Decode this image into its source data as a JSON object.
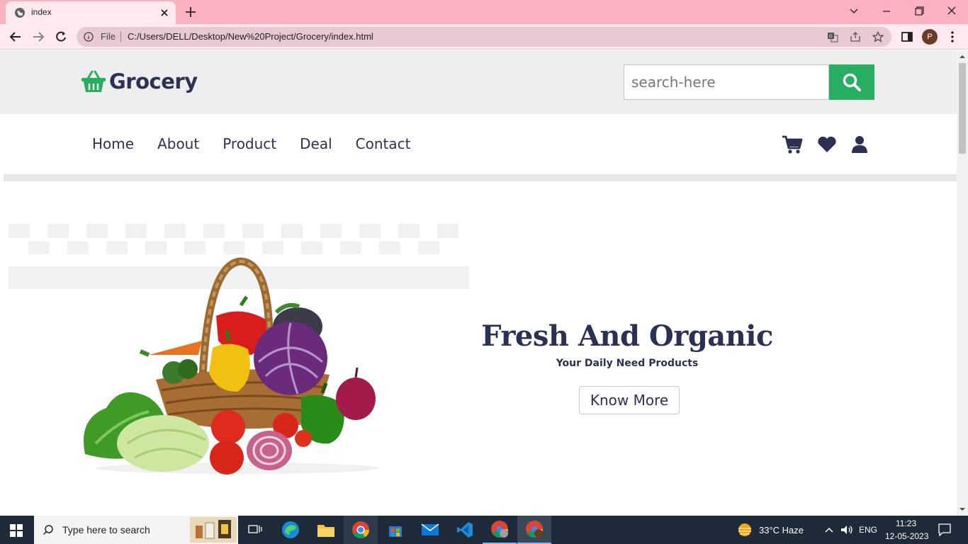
{
  "browser": {
    "tab_title": "index",
    "address": {
      "scheme_label": "File",
      "url": "C:/Users/DELL/Desktop/New%20Project/Grocery/index.html"
    },
    "profile_initial": "P"
  },
  "site": {
    "logo_text": "Grocery",
    "search": {
      "placeholder": "search-here"
    },
    "nav": [
      "Home",
      "About",
      "Product",
      "Deal",
      "Contact"
    ],
    "hero": {
      "title": "Fresh And Organic",
      "subtitle": "Your Daily Need Products",
      "button": "Know More"
    }
  },
  "taskbar": {
    "search_placeholder": "Type here to search",
    "weather": "33°C  Haze",
    "language": "ENG",
    "time": "11:23",
    "date": "12-05-2023"
  },
  "colors": {
    "accent": "#27ae60",
    "brand_text": "#2c3153",
    "tabbar": "#fcb1c0",
    "taskbar": "#1e2a38"
  },
  "icons": [
    "globe-icon",
    "close-icon",
    "plus-icon",
    "back-icon",
    "forward-icon",
    "reload-icon",
    "info-icon",
    "translate-icon",
    "share-icon",
    "star-icon",
    "sidepanel-icon",
    "basket-icon",
    "search-icon",
    "cart-icon",
    "heart-icon",
    "user-icon",
    "windows-icon"
  ]
}
